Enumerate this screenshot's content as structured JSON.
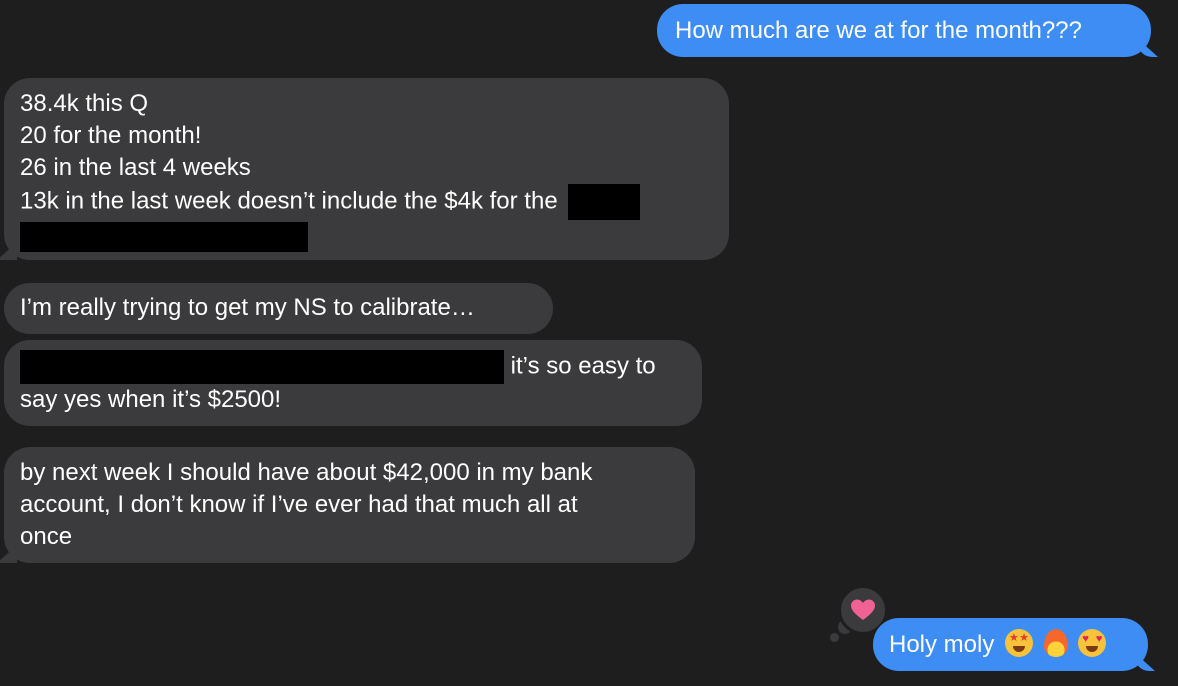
{
  "messages": {
    "m1": {
      "direction": "sent",
      "text": "How much are we at for the month???"
    },
    "m2": {
      "direction": "received",
      "lines": [
        "38.4k this Q",
        "20 for the month!",
        "26 in the last 4 weeks",
        "13k in the last week doesn’t include the $4k for the"
      ],
      "redacted": true
    },
    "m3": {
      "direction": "received",
      "text": "I’m really trying to get my NS to calibrate…"
    },
    "m4": {
      "direction": "received",
      "line1_suffix": "it’s so easy to",
      "line2": "say yes when it’s $2500!",
      "redacted": true
    },
    "m5": {
      "direction": "received",
      "lines": [
        "by next week I should have about $42,000 in my bank",
        "account, I don’t know if I’ve ever had that much all at",
        "once"
      ]
    },
    "m6": {
      "direction": "sent",
      "text": "Holy moly",
      "emojis": [
        "star-struck",
        "fire",
        "heart-eyes"
      ]
    }
  },
  "tapback": {
    "icon": "heart-icon",
    "color": "#f06292"
  },
  "colors": {
    "background": "#1e1e1e",
    "sent_bubble": "#3d8df5",
    "received_bubble": "#3b3b3d",
    "text": "#ffffff"
  }
}
